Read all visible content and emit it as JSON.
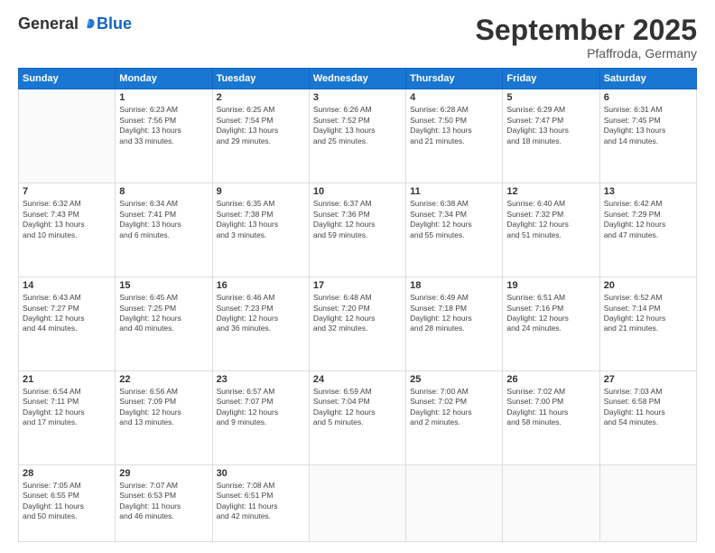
{
  "logo": {
    "general": "General",
    "blue": "Blue"
  },
  "title": "September 2025",
  "subtitle": "Pfaffroda, Germany",
  "days_header": [
    "Sunday",
    "Monday",
    "Tuesday",
    "Wednesday",
    "Thursday",
    "Friday",
    "Saturday"
  ],
  "weeks": [
    [
      {
        "day": "",
        "info": ""
      },
      {
        "day": "1",
        "info": "Sunrise: 6:23 AM\nSunset: 7:56 PM\nDaylight: 13 hours\nand 33 minutes."
      },
      {
        "day": "2",
        "info": "Sunrise: 6:25 AM\nSunset: 7:54 PM\nDaylight: 13 hours\nand 29 minutes."
      },
      {
        "day": "3",
        "info": "Sunrise: 6:26 AM\nSunset: 7:52 PM\nDaylight: 13 hours\nand 25 minutes."
      },
      {
        "day": "4",
        "info": "Sunrise: 6:28 AM\nSunset: 7:50 PM\nDaylight: 13 hours\nand 21 minutes."
      },
      {
        "day": "5",
        "info": "Sunrise: 6:29 AM\nSunset: 7:47 PM\nDaylight: 13 hours\nand 18 minutes."
      },
      {
        "day": "6",
        "info": "Sunrise: 6:31 AM\nSunset: 7:45 PM\nDaylight: 13 hours\nand 14 minutes."
      }
    ],
    [
      {
        "day": "7",
        "info": "Sunrise: 6:32 AM\nSunset: 7:43 PM\nDaylight: 13 hours\nand 10 minutes."
      },
      {
        "day": "8",
        "info": "Sunrise: 6:34 AM\nSunset: 7:41 PM\nDaylight: 13 hours\nand 6 minutes."
      },
      {
        "day": "9",
        "info": "Sunrise: 6:35 AM\nSunset: 7:38 PM\nDaylight: 13 hours\nand 3 minutes."
      },
      {
        "day": "10",
        "info": "Sunrise: 6:37 AM\nSunset: 7:36 PM\nDaylight: 12 hours\nand 59 minutes."
      },
      {
        "day": "11",
        "info": "Sunrise: 6:38 AM\nSunset: 7:34 PM\nDaylight: 12 hours\nand 55 minutes."
      },
      {
        "day": "12",
        "info": "Sunrise: 6:40 AM\nSunset: 7:32 PM\nDaylight: 12 hours\nand 51 minutes."
      },
      {
        "day": "13",
        "info": "Sunrise: 6:42 AM\nSunset: 7:29 PM\nDaylight: 12 hours\nand 47 minutes."
      }
    ],
    [
      {
        "day": "14",
        "info": "Sunrise: 6:43 AM\nSunset: 7:27 PM\nDaylight: 12 hours\nand 44 minutes."
      },
      {
        "day": "15",
        "info": "Sunrise: 6:45 AM\nSunset: 7:25 PM\nDaylight: 12 hours\nand 40 minutes."
      },
      {
        "day": "16",
        "info": "Sunrise: 6:46 AM\nSunset: 7:23 PM\nDaylight: 12 hours\nand 36 minutes."
      },
      {
        "day": "17",
        "info": "Sunrise: 6:48 AM\nSunset: 7:20 PM\nDaylight: 12 hours\nand 32 minutes."
      },
      {
        "day": "18",
        "info": "Sunrise: 6:49 AM\nSunset: 7:18 PM\nDaylight: 12 hours\nand 28 minutes."
      },
      {
        "day": "19",
        "info": "Sunrise: 6:51 AM\nSunset: 7:16 PM\nDaylight: 12 hours\nand 24 minutes."
      },
      {
        "day": "20",
        "info": "Sunrise: 6:52 AM\nSunset: 7:14 PM\nDaylight: 12 hours\nand 21 minutes."
      }
    ],
    [
      {
        "day": "21",
        "info": "Sunrise: 6:54 AM\nSunset: 7:11 PM\nDaylight: 12 hours\nand 17 minutes."
      },
      {
        "day": "22",
        "info": "Sunrise: 6:56 AM\nSunset: 7:09 PM\nDaylight: 12 hours\nand 13 minutes."
      },
      {
        "day": "23",
        "info": "Sunrise: 6:57 AM\nSunset: 7:07 PM\nDaylight: 12 hours\nand 9 minutes."
      },
      {
        "day": "24",
        "info": "Sunrise: 6:59 AM\nSunset: 7:04 PM\nDaylight: 12 hours\nand 5 minutes."
      },
      {
        "day": "25",
        "info": "Sunrise: 7:00 AM\nSunset: 7:02 PM\nDaylight: 12 hours\nand 2 minutes."
      },
      {
        "day": "26",
        "info": "Sunrise: 7:02 AM\nSunset: 7:00 PM\nDaylight: 11 hours\nand 58 minutes."
      },
      {
        "day": "27",
        "info": "Sunrise: 7:03 AM\nSunset: 6:58 PM\nDaylight: 11 hours\nand 54 minutes."
      }
    ],
    [
      {
        "day": "28",
        "info": "Sunrise: 7:05 AM\nSunset: 6:55 PM\nDaylight: 11 hours\nand 50 minutes."
      },
      {
        "day": "29",
        "info": "Sunrise: 7:07 AM\nSunset: 6:53 PM\nDaylight: 11 hours\nand 46 minutes."
      },
      {
        "day": "30",
        "info": "Sunrise: 7:08 AM\nSunset: 6:51 PM\nDaylight: 11 hours\nand 42 minutes."
      },
      {
        "day": "",
        "info": ""
      },
      {
        "day": "",
        "info": ""
      },
      {
        "day": "",
        "info": ""
      },
      {
        "day": "",
        "info": ""
      }
    ]
  ]
}
